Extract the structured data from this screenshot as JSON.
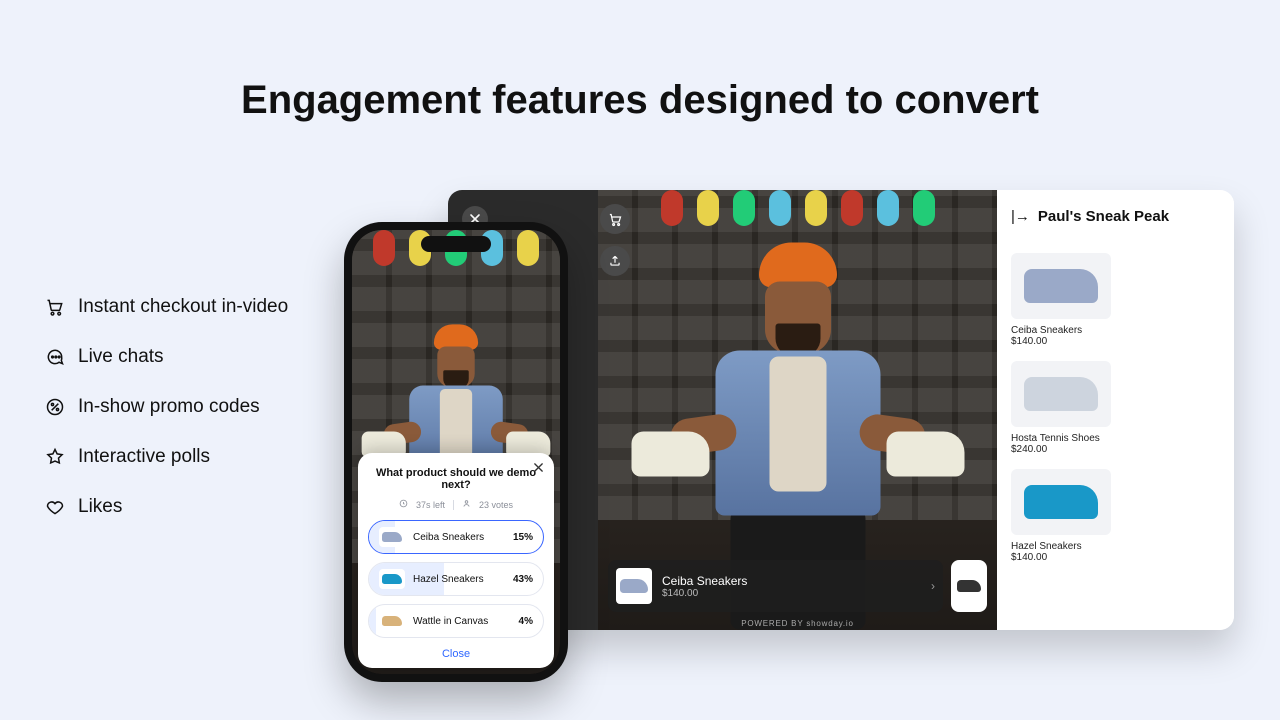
{
  "headline": "Engagement features designed to convert",
  "features": [
    {
      "icon": "cart-icon",
      "label": "Instant checkout in-video"
    },
    {
      "icon": "chat-icon",
      "label": "Live chats"
    },
    {
      "icon": "percent-icon",
      "label": "In-show promo codes"
    },
    {
      "icon": "star-icon",
      "label": "Interactive polls"
    },
    {
      "icon": "heart-icon",
      "label": "Likes"
    }
  ],
  "desktop": {
    "stream_title": "Paul's Sneak Peak",
    "chip": {
      "name": "Ceiba Sneakers",
      "price": "$140.00"
    },
    "powered": "POWERED BY   showday.io",
    "products": [
      {
        "name": "Ceiba Sneakers",
        "price": "$140.00",
        "color": "#9aa9c8"
      },
      {
        "name": "Hosta Tennis Shoes",
        "price": "$240.00",
        "color": "#cdd4de"
      },
      {
        "name": "Hazel Sneakers",
        "price": "$140.00",
        "color": "#1998c8"
      }
    ]
  },
  "poll": {
    "question": "What product should we demo next?",
    "time_left": "37s left",
    "votes": "23 votes",
    "close_label": "Close",
    "options": [
      {
        "name": "Ceiba Sneakers",
        "pct": "15%",
        "fill": 15,
        "selected": true,
        "color": "#9aa9c8"
      },
      {
        "name": "Hazel Sneakers",
        "pct": "43%",
        "fill": 43,
        "selected": false,
        "color": "#1998c8"
      },
      {
        "name": "Wattle in Canvas",
        "pct": "4%",
        "fill": 4,
        "selected": false,
        "color": "#d8b27a"
      }
    ]
  }
}
